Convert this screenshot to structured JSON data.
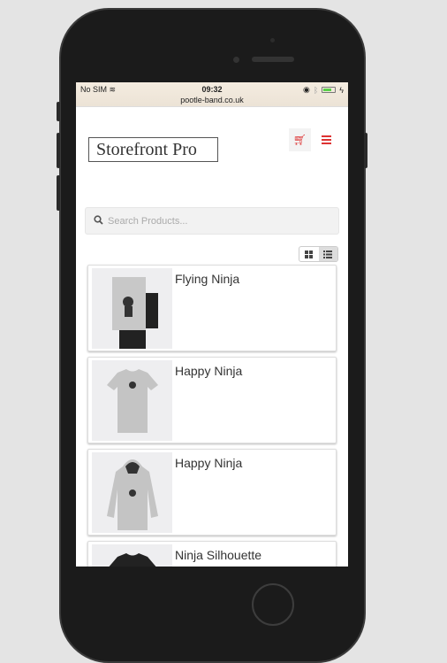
{
  "status_bar": {
    "carrier": "No SIM",
    "time": "09:32",
    "url": "pootle-band.co.uk"
  },
  "header": {
    "logo": "Storefront Pro"
  },
  "search": {
    "placeholder": "Search Products..."
  },
  "view_toggle": {
    "active": "list"
  },
  "products": [
    {
      "name": "Flying Ninja",
      "type": "poster"
    },
    {
      "name": "Happy Ninja",
      "type": "tshirt"
    },
    {
      "name": "Happy Ninja",
      "type": "hoodie"
    },
    {
      "name": "Ninja Silhouette",
      "type": "tshirt-dark"
    }
  ],
  "colors": {
    "accent": "#dd3333"
  }
}
